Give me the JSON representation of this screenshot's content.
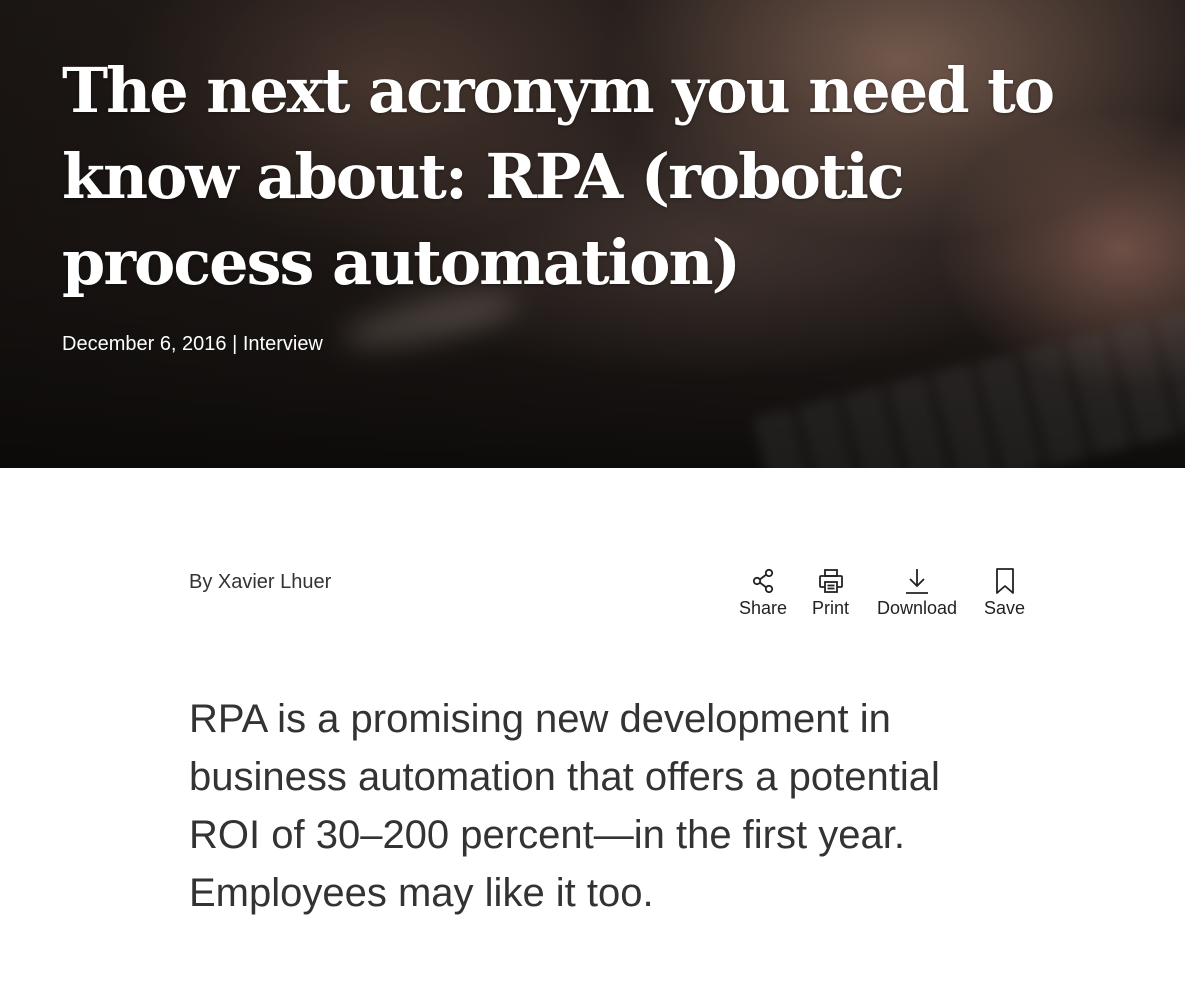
{
  "hero": {
    "title": "The next acronym you need to know about: RPA (robotic process automation)",
    "meta": "December 6, 2016 | Interview"
  },
  "byline": "By Xavier Lhuer",
  "actions": [
    {
      "label": "Share",
      "icon": "share-icon"
    },
    {
      "label": "Print",
      "icon": "print-icon"
    },
    {
      "label": "Download",
      "icon": "download-icon"
    },
    {
      "label": "Save",
      "icon": "bookmark-icon"
    }
  ],
  "dek": "RPA is a promising new development in business automation that offers a potential ROI of 30–200 percent—in the first year. Employees may like it too.",
  "colors": {
    "hero_text": "#ffffff",
    "body_text": "#333333",
    "icon": "#222222"
  }
}
